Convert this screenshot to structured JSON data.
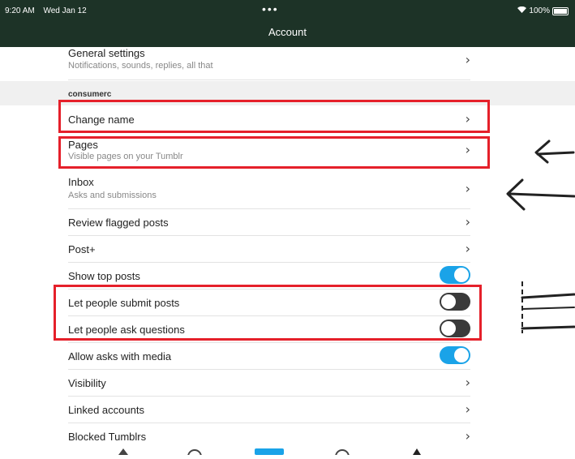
{
  "status": {
    "time": "9:20 AM",
    "date": "Wed Jan 12",
    "dots": "•••",
    "battery": "100%"
  },
  "nav": {
    "title": "Account"
  },
  "rows": {
    "general": {
      "title": "General settings",
      "sub": "Notifications, sounds, replies, all that"
    },
    "section": "consumerc",
    "change_name": {
      "title": "Change name"
    },
    "pages": {
      "title": "Pages",
      "sub": "Visible pages on your Tumblr"
    },
    "inbox": {
      "title": "Inbox",
      "sub": "Asks and submissions"
    },
    "flagged": {
      "title": "Review flagged posts"
    },
    "postplus": {
      "title": "Post+"
    },
    "top_posts": {
      "title": "Show top posts",
      "on": true
    },
    "submit": {
      "title": "Let people submit posts",
      "on": false
    },
    "ask": {
      "title": "Let people ask questions",
      "on": false
    },
    "asks_media": {
      "title": "Allow asks with media",
      "on": true
    },
    "visibility": {
      "title": "Visibility"
    },
    "linked": {
      "title": "Linked accounts"
    },
    "blocked": {
      "title": "Blocked Tumblrs"
    }
  },
  "chevron": "›",
  "colors": {
    "header": "#1d3327",
    "toggle_on": "#1aa3e8",
    "toggle_off": "#3a3a3a",
    "highlight": "#e5202a"
  }
}
